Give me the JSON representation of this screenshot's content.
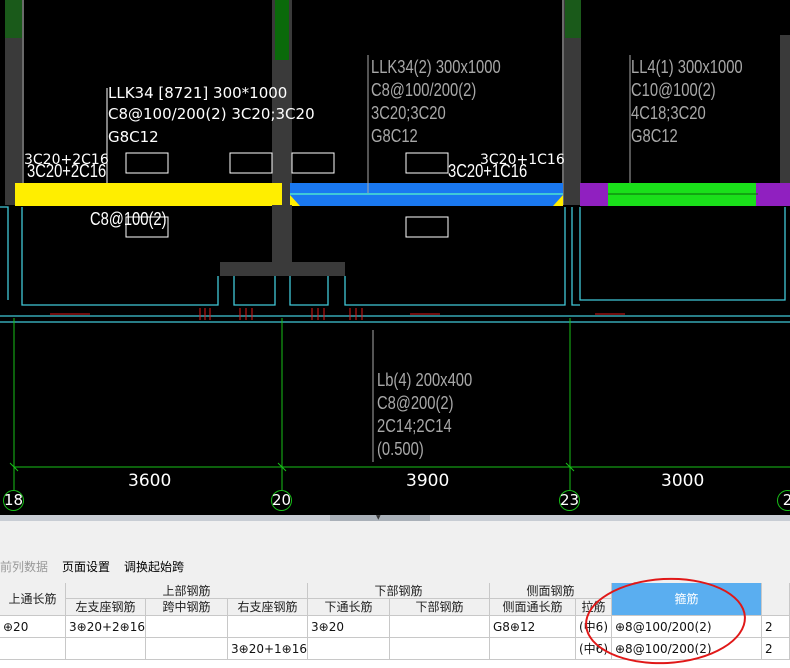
{
  "drawing": {
    "beams": [
      {
        "name": "LLK34 [8721] 300*1000",
        "stirrup": "C8@100/200(2) 3C20;3C20",
        "side": "G8C12"
      },
      {
        "name": "LLK34(2) 300x1000",
        "stirrup": "C8@100/200(2)",
        "long": "3C20;3C20",
        "side": "G8C12"
      },
      {
        "name": "LL4(1) 300x1000",
        "stirrup": "C10@100(2)",
        "long": "4C18;3C20",
        "side": "G8C12"
      },
      {
        "name": "Lb(4) 200x400",
        "stirrup": "C8@200(2)",
        "long": "2C14;2C14",
        "elev": "(0.500)"
      }
    ],
    "left_support_top": "3C20+2C16",
    "left_support_bottom": "3C20+2C16",
    "right_support_top": "3C20+1C16",
    "right_support_bottom": "3C20+1C16",
    "bottom_stirrup": "C8@100(2)",
    "dimensions": [
      "3600",
      "3900",
      "3000"
    ],
    "axes": [
      "18",
      "20",
      "23",
      "2"
    ],
    "colors": {
      "yellow": "#ffee00",
      "blue": "#1a78f0",
      "green": "#1ae01a",
      "cyan": "#40c8d8",
      "purple": "#9020c0",
      "axis": "#18c018",
      "red": "#e01818"
    }
  },
  "toolbar": {
    "items": [
      "前列数据",
      "页面设置",
      "调换起始跨"
    ]
  },
  "table": {
    "group_headers": [
      "上部钢筋",
      "下部钢筋",
      "侧面钢筋"
    ],
    "columns": [
      "上通长筋",
      "左支座钢筋",
      "跨中钢筋",
      "右支座钢筋",
      "下通长筋",
      "下部钢筋",
      "侧面通长筋",
      "拉筋",
      "箍筋"
    ],
    "rows": [
      {
        "c0": "⊕20",
        "c1": "3⊕20+2⊕16",
        "c2": "",
        "c3": "",
        "c4": "3⊕20",
        "c5": "",
        "c6": "G8⊕12",
        "c7": "(中6)",
        "c8": "⊕8@100/200(2)",
        "c9": "2"
      },
      {
        "c0": "",
        "c1": "",
        "c2": "",
        "c3": "3⊕20+1⊕16",
        "c4": "",
        "c5": "",
        "c6": "",
        "c7": "(中6)",
        "c8": "⊕8@100/200(2)",
        "c9": "2"
      }
    ]
  }
}
